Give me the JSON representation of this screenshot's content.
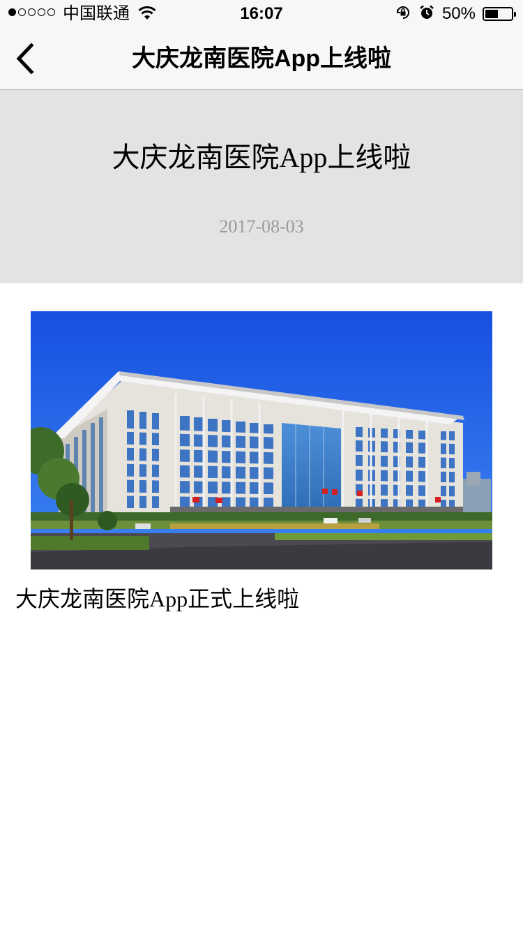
{
  "status_bar": {
    "carrier": "中国联通",
    "time": "16:07",
    "battery_percent_label": "50%",
    "battery_level": 0.5,
    "signal_bars_filled": 1,
    "signal_bars_total": 5,
    "icons": [
      "wifi-icon",
      "orientation-lock-icon",
      "alarm-icon",
      "battery-icon"
    ]
  },
  "navbar": {
    "title": "大庆龙南医院App上线啦",
    "back_icon": "chevron-left-icon"
  },
  "article": {
    "title": "大庆龙南医院App上线啦",
    "date": "2017-08-03",
    "image_subject": "hospital building under blue sky",
    "body": "大庆龙南医院App正式上线啦"
  },
  "colors": {
    "header_bg": "#e3e3e3",
    "date_text": "#9a9a9a",
    "sky": "#1f5fe0"
  }
}
